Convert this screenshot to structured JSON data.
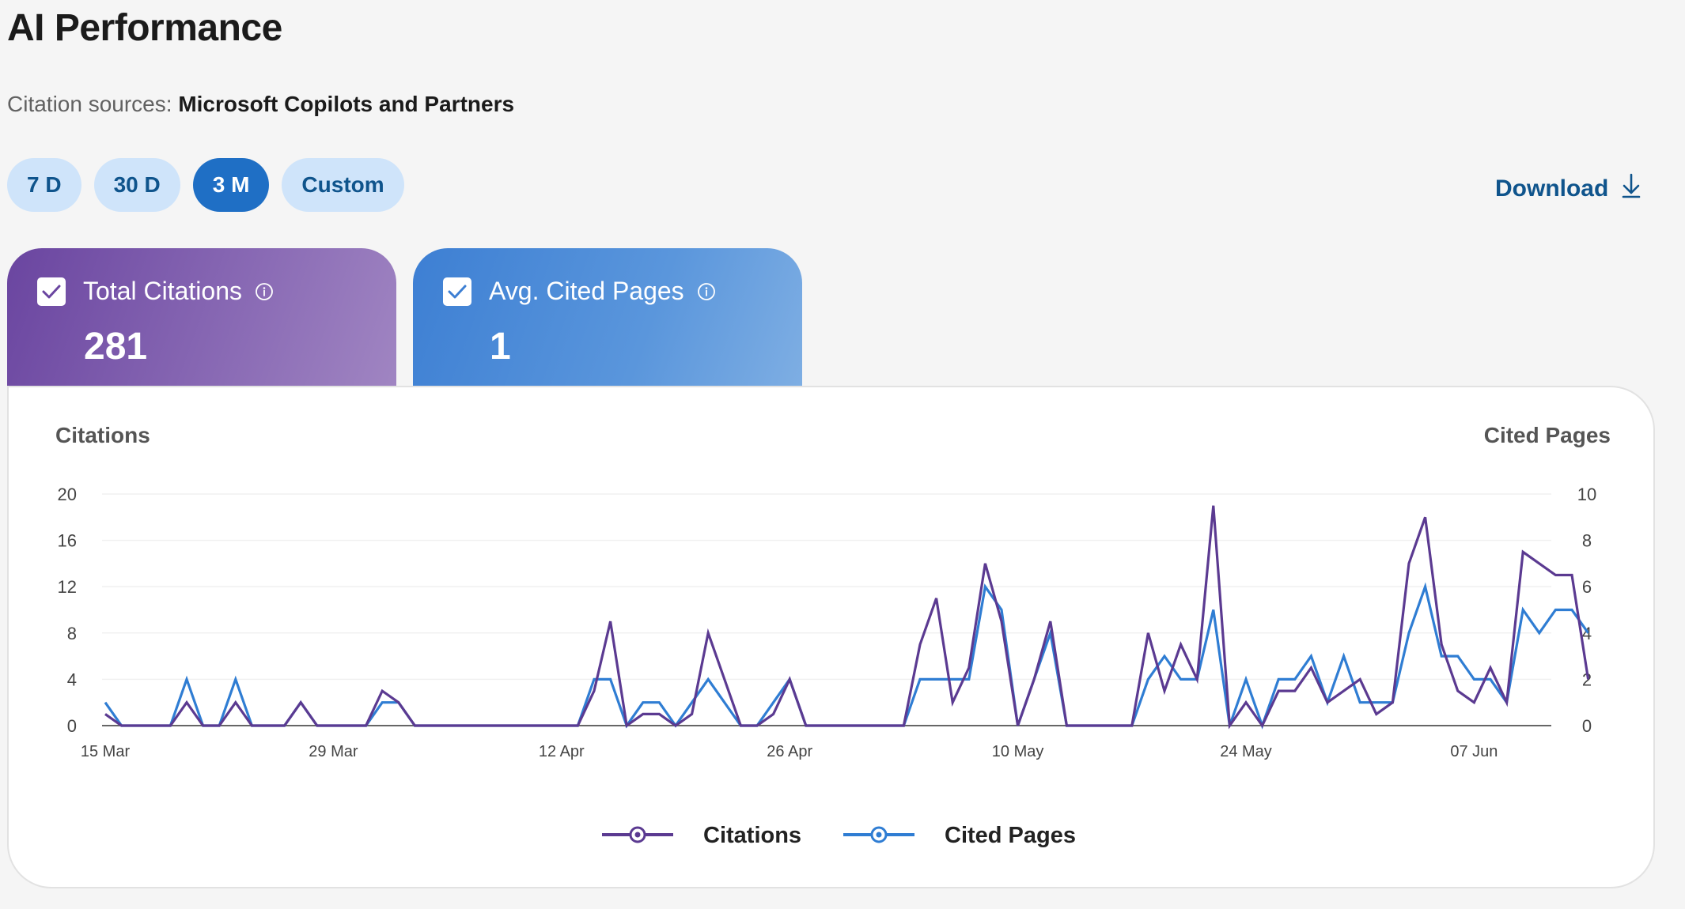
{
  "header": {
    "title": "AI Performance",
    "sources_label": "Citation sources:",
    "sources_value": "Microsoft Copilots and Partners"
  },
  "range": {
    "options": [
      "7 D",
      "30 D",
      "3 M",
      "Custom"
    ],
    "selected": "3 M"
  },
  "download": {
    "label": "Download",
    "icon": "download-arrow-icon"
  },
  "cards": [
    {
      "title": "Total Citations",
      "value": "281",
      "checked": true,
      "color": "#6a45a0",
      "icon": "info-icon"
    },
    {
      "title": "Avg. Cited Pages",
      "value": "1",
      "checked": true,
      "color": "#3d7fd3",
      "icon": "info-icon"
    }
  ],
  "chart_data": {
    "type": "line",
    "ylabel": "Citations",
    "y2label": "Cited Pages",
    "ylim": [
      0,
      20
    ],
    "y2lim": [
      0,
      10
    ],
    "yticks": [
      0,
      4,
      8,
      12,
      16,
      20
    ],
    "y2ticks": [
      0,
      2,
      4,
      6,
      8,
      10
    ],
    "x_start": "15 Mar",
    "x_tick_labels": [
      {
        "label": "15 Mar",
        "index": 0
      },
      {
        "label": "29 Mar",
        "index": 14
      },
      {
        "label": "12 Apr",
        "index": 28
      },
      {
        "label": "26 Apr",
        "index": 42
      },
      {
        "label": "10 May",
        "index": 56
      },
      {
        "label": "24 May",
        "index": 70
      },
      {
        "label": "07 Jun",
        "index": 84
      }
    ],
    "grid": true,
    "legend_position": "bottom",
    "series": [
      {
        "name": "Citations",
        "axis": "left",
        "color": "#5b3a91",
        "values": [
          1,
          0,
          0,
          0,
          0,
          2,
          0,
          0,
          2,
          0,
          0,
          0,
          2,
          0,
          0,
          0,
          0,
          3,
          2,
          0,
          0,
          0,
          0,
          0,
          0,
          0,
          0,
          0,
          0,
          0,
          3,
          9,
          0,
          1,
          1,
          0,
          1,
          8,
          4,
          0,
          0,
          1,
          4,
          0,
          0,
          0,
          0,
          0,
          0,
          0,
          7,
          11,
          2,
          5,
          14,
          9,
          0,
          4,
          9,
          0,
          0,
          0,
          0,
          0,
          8,
          3,
          7,
          4,
          19,
          0,
          2,
          0,
          3,
          3,
          5,
          2,
          3,
          4,
          1,
          2,
          14,
          18,
          7,
          3,
          2,
          5,
          2,
          15,
          14,
          13,
          13,
          4
        ]
      },
      {
        "name": "Cited Pages",
        "axis": "right",
        "color": "#2f7dd3",
        "values": [
          1,
          0,
          0,
          0,
          0,
          2,
          0,
          0,
          2,
          0,
          0,
          0,
          1,
          0,
          0,
          0,
          0,
          1,
          1,
          0,
          0,
          0,
          0,
          0,
          0,
          0,
          0,
          0,
          0,
          0,
          2,
          2,
          0,
          1,
          1,
          0,
          1,
          2,
          1,
          0,
          0,
          1,
          2,
          0,
          0,
          0,
          0,
          0,
          0,
          0,
          2,
          2,
          2,
          2,
          6,
          5,
          0,
          2,
          4,
          0,
          0,
          0,
          0,
          0,
          2,
          3,
          2,
          2,
          5,
          0,
          2,
          0,
          2,
          2,
          3,
          1,
          3,
          1,
          1,
          1,
          4,
          6,
          3,
          3,
          2,
          2,
          1,
          5,
          4,
          5,
          5,
          4
        ]
      }
    ]
  }
}
